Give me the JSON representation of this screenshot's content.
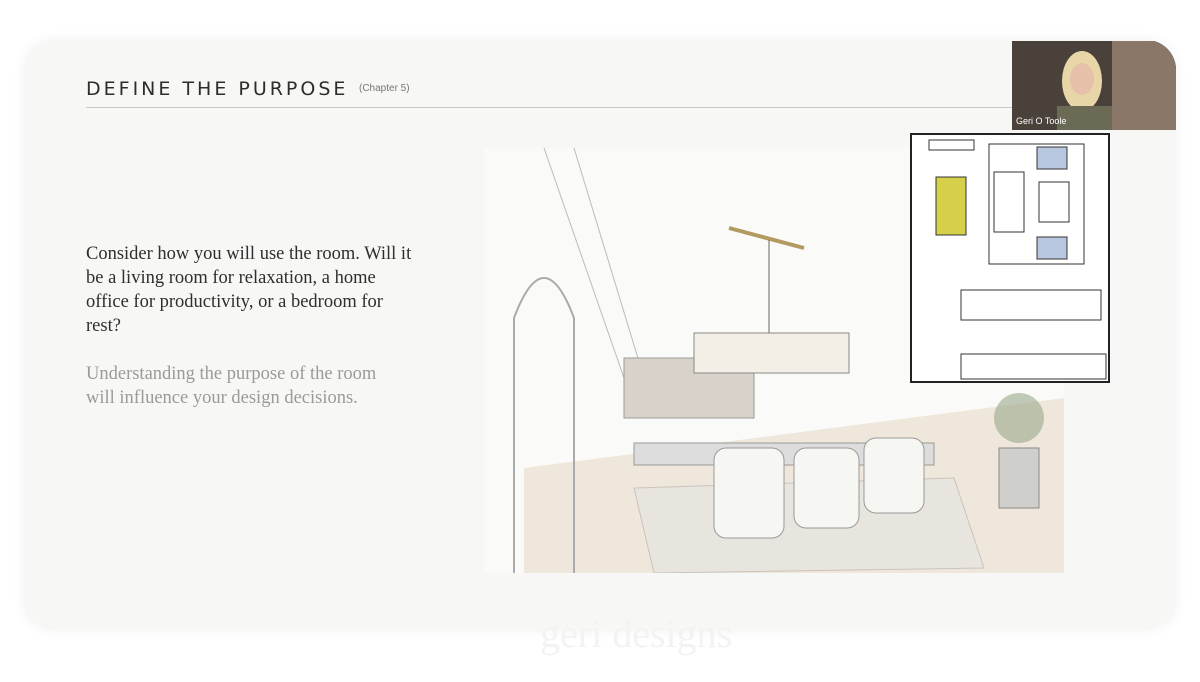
{
  "slide": {
    "title": "DEFINE THE PURPOSE",
    "chapter": "(Chapter 5)",
    "paragraph_1": "Consider how you will use the room. Will it be a living room for relaxation, a home office for productivity, or a bedroom for rest?",
    "paragraph_2": "Understanding the purpose of the room will influence your design decisions.",
    "watermark": "geri designs"
  },
  "video": {
    "participant_name": "Geri O Toole"
  },
  "colors": {
    "table_accent": "#d6cf4a",
    "chair_accent": "#b9c8e0"
  }
}
